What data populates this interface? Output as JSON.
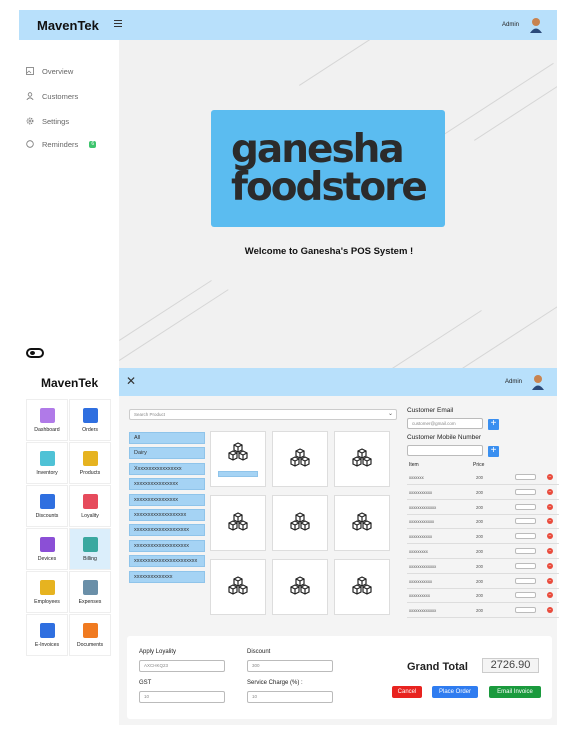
{
  "top": {
    "brand": "MavenTek",
    "admin_label": "Admin",
    "nav": [
      {
        "label": "Overview",
        "icon": "image-icon"
      },
      {
        "label": "Customers",
        "icon": "user-icon"
      },
      {
        "label": "Settings",
        "icon": "gear-icon"
      },
      {
        "label": "Reminders",
        "icon": "chat-icon",
        "badge": "6"
      }
    ],
    "logo_line1": "ganesha",
    "logo_line2": "foodstore",
    "welcome": "Welcome to Ganesha's POS System !"
  },
  "bottom": {
    "brand": "MavenTek",
    "admin_label": "Admin",
    "tiles": [
      {
        "label": "Dashboard",
        "color": "#b07ae8"
      },
      {
        "label": "Orders",
        "color": "#2f6fe0"
      },
      {
        "label": "Inventory",
        "color": "#4fc2d6"
      },
      {
        "label": "Products",
        "color": "#e6b320"
      },
      {
        "label": "Discounts",
        "color": "#2f6fe0"
      },
      {
        "label": "Loyality",
        "color": "#e64b5c"
      },
      {
        "label": "Devices",
        "color": "#8b4fd6"
      },
      {
        "label": "Billing",
        "color": "#3aa8a0"
      },
      {
        "label": "Employees",
        "color": "#e6b320"
      },
      {
        "label": "Expenses",
        "color": "#6a8fa8"
      },
      {
        "label": "E-Invoices",
        "color": "#2f6fe0"
      },
      {
        "label": "Documents",
        "color": "#f07a20"
      }
    ],
    "search_placeholder": "Search Product",
    "categories": [
      "All",
      "Dairy",
      "Xxxxxxxxxxxxxxxxx",
      "xxxxxxxxxxxxxxxx",
      "xxxxxxxxxxxxxxxx",
      "xxxxxxxxxxxxxxxxxxx",
      "xxxxxxxxxxxxxxxxxxxx",
      "xxxxxxxxxxxxxxxxxxxx",
      "xxxxxxxxxxxxxxxxxxxxxxx",
      "xxxxxxxxxxxxxx"
    ],
    "customer_email_label": "Customer Email",
    "customer_email_placeholder": "customer@gmail.com",
    "customer_mobile_label": "Customer Mobile Number",
    "col_item": "Item",
    "col_price": "Price",
    "cart_rows": [
      {
        "item": "xxxxxxx",
        "price": "200"
      },
      {
        "item": "xxxxxxxxxxx",
        "price": "200"
      },
      {
        "item": "xxxxxxxxxxxxx",
        "price": "200"
      },
      {
        "item": "xxxxxxxxxxxx",
        "price": "200"
      },
      {
        "item": "xxxxxxxxxxx",
        "price": "200"
      },
      {
        "item": "xxxxxxxxx",
        "price": "200"
      },
      {
        "item": "xxxxxxxxxxxxx",
        "price": "200"
      },
      {
        "item": "xxxxxxxxxxx",
        "price": "200"
      },
      {
        "item": "xxxxxxxxxx",
        "price": "200"
      },
      {
        "item": "xxxxxxxxxxxxx",
        "price": "200"
      }
    ],
    "apply_loyality_label": "Apply Loyality",
    "loyality_code": "AXCHKQ23",
    "discount_label": "Discount",
    "discount_value": "300",
    "gst_label": "GST",
    "gst_value": "10",
    "service_label": "Service Charge (%) :",
    "service_value": "10",
    "grand_total_label": "Grand Total",
    "grand_total_value": "2726.90",
    "cancel_label": "Cancel",
    "place_order_label": "Place Order",
    "email_invoice_label": "Email Invoice",
    "colors": {
      "cancel": "#e8231f",
      "place_order": "#2f7cf0",
      "email_invoice": "#1a9a3d",
      "header": "#b8e0fb",
      "category": "#a5d3f4"
    }
  }
}
